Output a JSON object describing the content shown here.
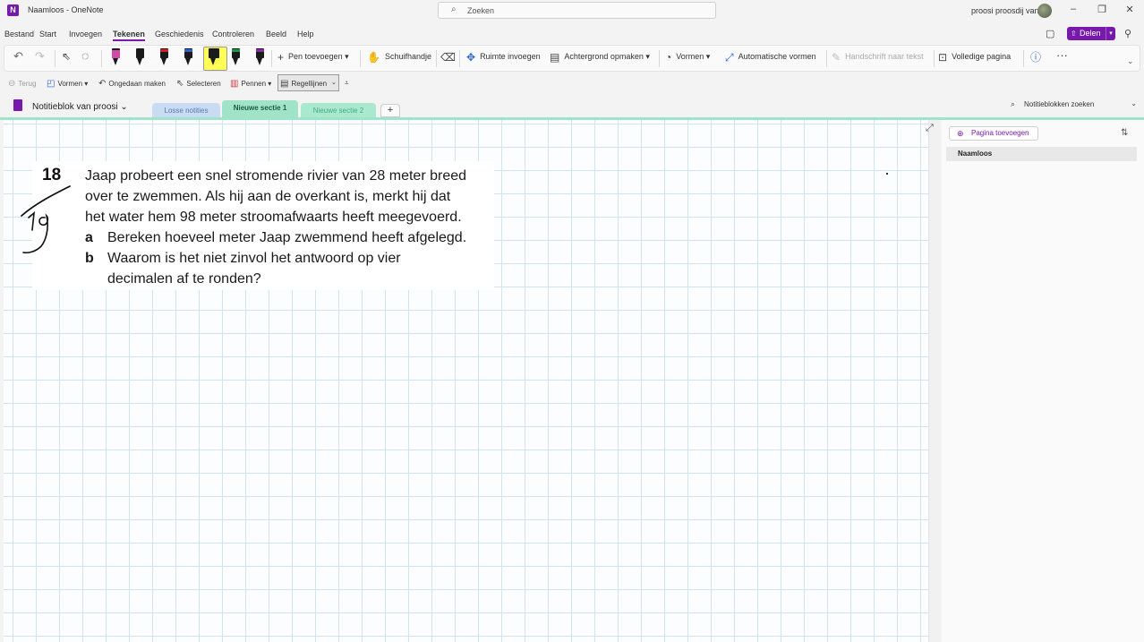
{
  "window": {
    "title": "Naamloos  -  OneNote",
    "app_icon": "onenote-logo",
    "search_placeholder": "Zoeken",
    "user_name": "proosi proosdij van",
    "controls": [
      "–",
      "❐",
      "✕"
    ]
  },
  "menu": {
    "items": [
      "Bestand",
      "Start",
      "Invoegen",
      "Tekenen",
      "Geschiedenis",
      "Controleren",
      "Beeld",
      "Help"
    ],
    "active": "Tekenen",
    "share_label": "Delen"
  },
  "ribbon": {
    "pen_toevoegen": "Pen toevoegen",
    "schuifhandje": "Schuifhandje",
    "ruimte_invoegen": "Ruimte invoegen",
    "achtergrond_opmaken": "Achtergrond opmaken",
    "vormen": "Vormen",
    "automatische_vormen": "Automatische vormen",
    "handschrift_naar_tekst": "Handschrift naar tekst",
    "volledige_pagina": "Volledige pagina",
    "more": "···",
    "pens": [
      {
        "color": "#d04aa8",
        "band": "#d04aa8"
      },
      {
        "color": "#111111",
        "band": "#111111"
      },
      {
        "color": "#111111",
        "band": "#d21f2a"
      },
      {
        "color": "#111111",
        "band": "#2b63d0"
      },
      {
        "color": "#111111",
        "band": "#e0d000"
      },
      {
        "color": "#111111",
        "band": "#1a9a48"
      },
      {
        "color": "#111111",
        "band": "#8b2aa8"
      }
    ]
  },
  "toolbar2": {
    "terug": "Terug",
    "vormen": "Vormen",
    "ongedaan_maken": "Ongedaan maken",
    "selecteren": "Selecteren",
    "pennen": "Pennen",
    "regellijnen": "Regellijnen"
  },
  "notebook": {
    "name": "Notitieblok van proosi",
    "tabs": [
      "Losse notities",
      "Nieuwe sectie 1",
      "Nieuwe sectie 2"
    ],
    "add_tab": "+",
    "search_placeholder": "Notitieblokken zoeken"
  },
  "exercise": {
    "number": "18",
    "lines": [
      "Jaap probeert een snel stromende rivier van 28 meter breed",
      "over te zwemmen. Als hij aan de overkant is, merkt hij dat",
      "het water hem 98 meter stroomafwaarts heeft meegevoerd."
    ],
    "sub": [
      {
        "letter": "a",
        "lines": [
          "Bereken hoeveel meter Jaap zwemmend heeft afgelegd."
        ]
      },
      {
        "letter": "b",
        "lines": [
          "Waarom is het niet zinvol het antwoord op vier",
          "decimalen af te ronden?"
        ]
      }
    ]
  },
  "pages": {
    "add_label": "Pagina toevoegen",
    "items": [
      "Naamloos"
    ]
  }
}
